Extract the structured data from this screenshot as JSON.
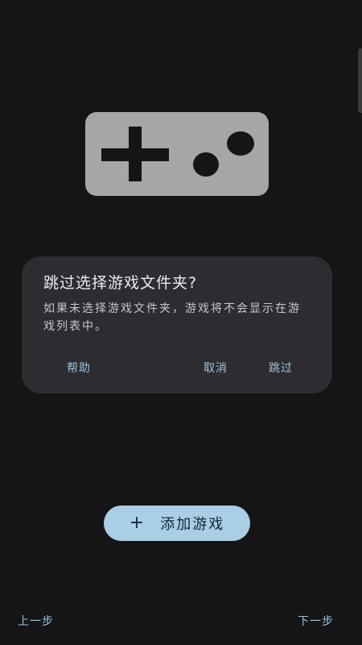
{
  "dialog": {
    "title": "跳过选择游戏文件夹?",
    "message": "如果未选择游戏文件夹，游戏将不会显示在游戏列表中。",
    "help_label": "帮助",
    "cancel_label": "取消",
    "skip_label": "跳过"
  },
  "add_game": {
    "icon": "+",
    "label": "添加游戏"
  },
  "navigation": {
    "prev_label": "上一步",
    "next_label": "下一步"
  },
  "colors": {
    "background": "#151417",
    "dialog": "#2d2c30",
    "accent": "#a9cee6",
    "text_button": "#9cc3df",
    "illustration": "#a6a6a8"
  },
  "icons": {
    "illustration": "gamepad-icon",
    "add": "plus-icon"
  }
}
